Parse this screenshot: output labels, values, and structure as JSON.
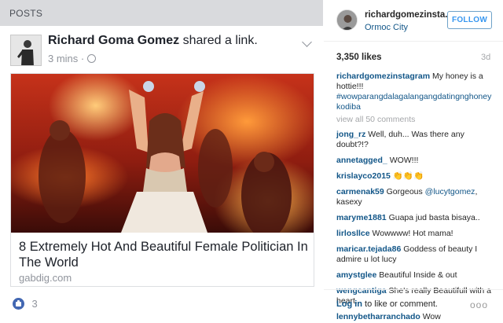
{
  "facebook": {
    "header_title": "POSTS",
    "post": {
      "author": "Richard Goma Gomez",
      "action": "shared a link.",
      "time": "3 mins",
      "separator": "·",
      "link": {
        "title": "8 Extremely Hot And Beautiful Female Politician In The World",
        "domain": "gabdig.com"
      },
      "likes": "3"
    }
  },
  "instagram": {
    "username": "richardgomezinsta...",
    "location": "Ormoc City",
    "follow_label": "FOLLOW",
    "likes": "3,350 likes",
    "age": "3d",
    "caption": {
      "user": "richardgomezinstagram",
      "text": "My honey is a hottie!!!",
      "hashtag": "#wowparangdalagalangangdatingnghoney kodiba"
    },
    "view_all": "view all 50 comments",
    "comments": [
      {
        "user": "jong_rz",
        "text": "Well, duh... Was there any doubt?!?"
      },
      {
        "user": "annetagged_",
        "text": "WOW!!!"
      },
      {
        "user": "krislayco2015",
        "text": "👏👏👏"
      },
      {
        "user": "carmenak59",
        "text": "Gorgeous ",
        "mention": "@lucytgomez",
        "text2": ", kasexy"
      },
      {
        "user": "maryme1881",
        "text": "Guapa jud basta bisaya.."
      },
      {
        "user": "lirlosllce",
        "text": "Wowwww! Hot mama!"
      },
      {
        "user": "maricar.tejada86",
        "text": "Goddess of beauty I admire u lot lucy"
      },
      {
        "user": "amystglee",
        "text": "Beautiful Inside & out"
      },
      {
        "user": "wengcantiga",
        "text": "She's really Beautifull with a heart..."
      },
      {
        "user": "lennybetharranchado",
        "text": "Wow"
      }
    ],
    "footer": {
      "login_link": "Log in",
      "login_text": " to like or comment.",
      "more": "ooo"
    }
  },
  "icons": [
    "globe-icon",
    "chevron-down-icon",
    "like-icon",
    "more-options-icon"
  ],
  "colors": {
    "facebook_blue": "#4267b2",
    "instagram_link": "#125688",
    "follow_blue": "#3897f0",
    "meta_gray": "#90949c"
  }
}
